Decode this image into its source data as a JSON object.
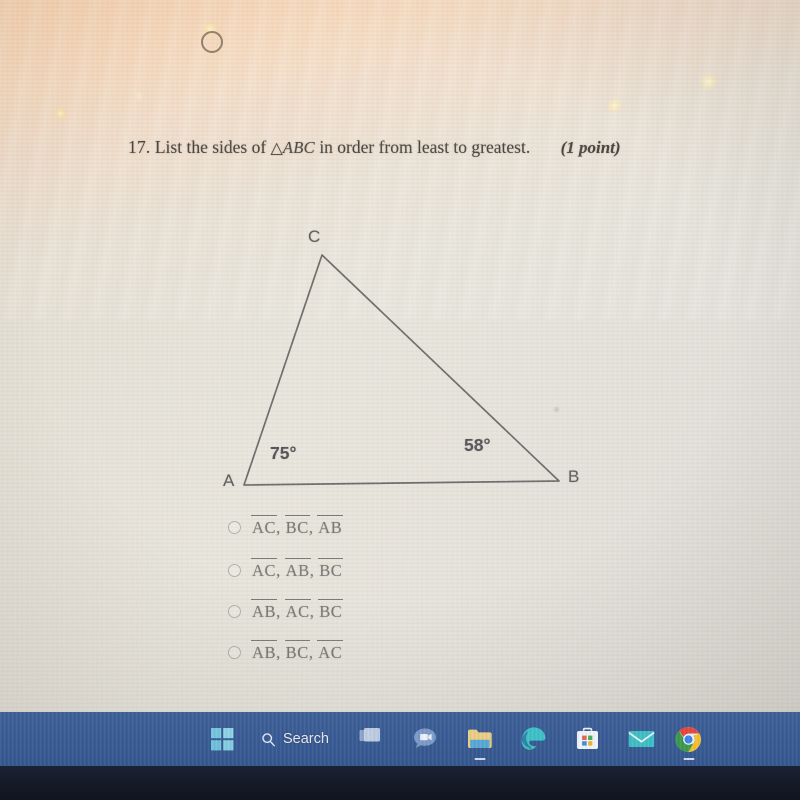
{
  "worksheet": {
    "question_number": "17.",
    "question_text_before": "List the sides of",
    "triangle_symbol": "△",
    "triangle_name": "ABC",
    "question_text_after": "in order from least to greatest.",
    "points": "(1 point)",
    "figure": {
      "vertex_a_label": "A",
      "vertex_b_label": "B",
      "vertex_c_label": "C",
      "angle_a": "75°",
      "angle_b": "58°",
      "stroke_color": "#6e6d6b"
    },
    "options": [
      {
        "id": "option-a",
        "seg1": "AC",
        "seg2": "BC",
        "seg3": "AB",
        "sep": ","
      },
      {
        "id": "option-b",
        "seg1": "AC",
        "seg2": "AB",
        "seg3": "BC",
        "sep": ","
      },
      {
        "id": "option-c",
        "seg1": "AB",
        "seg2": "AC",
        "seg3": "BC",
        "sep": ","
      },
      {
        "id": "option-d",
        "seg1": "AB",
        "seg2": "BC",
        "seg3": "AC",
        "sep": ","
      }
    ]
  },
  "taskbar": {
    "search_label": "Search",
    "accent_color": "#3a5d96",
    "items": [
      {
        "name": "start-button",
        "icon": "windows-logo-icon"
      },
      {
        "name": "search-button",
        "icon": "search-icon"
      },
      {
        "name": "task-view-button",
        "icon": "task-view-icon"
      },
      {
        "name": "chat-button",
        "icon": "chat-icon"
      },
      {
        "name": "file-explorer-button",
        "icon": "folder-icon"
      },
      {
        "name": "edge-button",
        "icon": "edge-icon"
      },
      {
        "name": "microsoft-store-button",
        "icon": "store-icon"
      },
      {
        "name": "mail-button",
        "icon": "mail-icon"
      },
      {
        "name": "chrome-button",
        "icon": "chrome-icon"
      }
    ]
  }
}
